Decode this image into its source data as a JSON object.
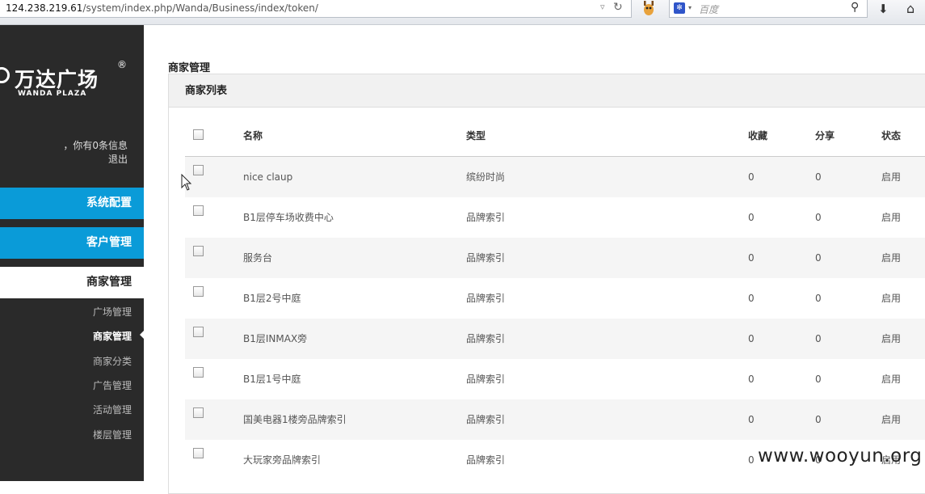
{
  "browser": {
    "url_host": "124.238.219.61",
    "url_path": "/system/index.php/Wanda/Business/index/token/",
    "search_placeholder": "百度",
    "search_engine_icon": "baidu-paw-icon",
    "addon_icon": "giraffe-icon"
  },
  "sidebar": {
    "logo_cn": "万达广场",
    "logo_en": "WANDA PLAZA",
    "logo_reg": "®",
    "user_message": "，你有0条信息",
    "logout": "退出",
    "nav": {
      "system_config": "系统配置",
      "customer_mgmt": "客户管理",
      "merchant_mgmt": "商家管理"
    },
    "sub_items": [
      "广场管理",
      "商家管理",
      "商家分类",
      "广告管理",
      "活动管理",
      "楼层管理"
    ],
    "active_sub_index": 1,
    "accent_color": "#0a9bd8",
    "bg_color": "#2a2a2a"
  },
  "main": {
    "page_title": "商家管理",
    "panel_title": "商家列表",
    "columns": {
      "name": "名称",
      "type": "类型",
      "favorites": "收藏",
      "shares": "分享",
      "status": "状态"
    },
    "rows": [
      {
        "name": "nice claup",
        "type": "缤纷时尚",
        "favorites": "0",
        "shares": "0",
        "status": "启用"
      },
      {
        "name": "B1层停车场收费中心",
        "type": "品牌索引",
        "favorites": "0",
        "shares": "0",
        "status": "启用"
      },
      {
        "name": "服务台",
        "type": "品牌索引",
        "favorites": "0",
        "shares": "0",
        "status": "启用"
      },
      {
        "name": "B1层2号中庭",
        "type": "品牌索引",
        "favorites": "0",
        "shares": "0",
        "status": "启用"
      },
      {
        "name": "B1层INMAX旁",
        "type": "品牌索引",
        "favorites": "0",
        "shares": "0",
        "status": "启用"
      },
      {
        "name": "B1层1号中庭",
        "type": "品牌索引",
        "favorites": "0",
        "shares": "0",
        "status": "启用"
      },
      {
        "name": "国美电器1楼旁品牌索引",
        "type": "品牌索引",
        "favorites": "0",
        "shares": "0",
        "status": "启用"
      },
      {
        "name": "大玩家旁品牌索引",
        "type": "品牌索引",
        "favorites": "0",
        "shares": "0",
        "status": "启用"
      }
    ]
  },
  "watermark": "www.wooyun.org"
}
